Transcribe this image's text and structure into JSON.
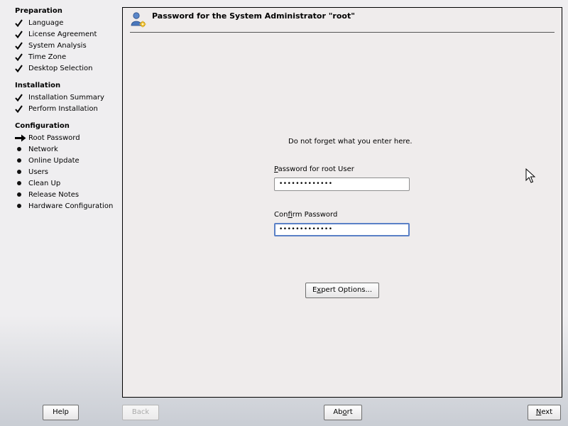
{
  "sidebar": {
    "sections": [
      {
        "title": "Preparation",
        "steps": [
          {
            "label": "Language",
            "state": "done"
          },
          {
            "label": "License Agreement",
            "state": "done"
          },
          {
            "label": "System Analysis",
            "state": "done"
          },
          {
            "label": "Time Zone",
            "state": "done"
          },
          {
            "label": "Desktop Selection",
            "state": "done"
          }
        ]
      },
      {
        "title": "Installation",
        "steps": [
          {
            "label": "Installation Summary",
            "state": "done"
          },
          {
            "label": "Perform Installation",
            "state": "done"
          }
        ]
      },
      {
        "title": "Configuration",
        "steps": [
          {
            "label": "Root Password",
            "state": "current"
          },
          {
            "label": "Network",
            "state": "pending"
          },
          {
            "label": "Online Update",
            "state": "pending"
          },
          {
            "label": "Users",
            "state": "pending"
          },
          {
            "label": "Clean Up",
            "state": "pending"
          },
          {
            "label": "Release Notes",
            "state": "pending"
          },
          {
            "label": "Hardware Configuration",
            "state": "pending"
          }
        ]
      }
    ],
    "icons": {
      "done": "checkmark-icon",
      "current": "arrow-right-icon",
      "pending": "bullet-icon"
    }
  },
  "dialog": {
    "title": "Password for the System Administrator \"root\"",
    "title_icon": "user-key-icon",
    "hint": "Do not forget what you enter here.",
    "password_label_mnemonic": "P",
    "password_label_rest": "assword for root User",
    "password_value": "•••••••••••••",
    "confirm_label_first": "Con",
    "confirm_label_mnemonic": "f",
    "confirm_label_rest": "irm Password",
    "confirm_value": "•••••••••••••",
    "expert_first": "E",
    "expert_mnemonic": "x",
    "expert_rest": "pert Options..."
  },
  "buttons": {
    "help": "Help",
    "back": "Back",
    "abort_first": "Ab",
    "abort_mnemonic": "o",
    "abort_rest": "rt",
    "next_mnemonic": "N",
    "next_rest": "ext"
  },
  "colors": {
    "focus_border": "#5a80c6",
    "panel_bg": "#efecec",
    "page_bg": "#efeef0"
  }
}
